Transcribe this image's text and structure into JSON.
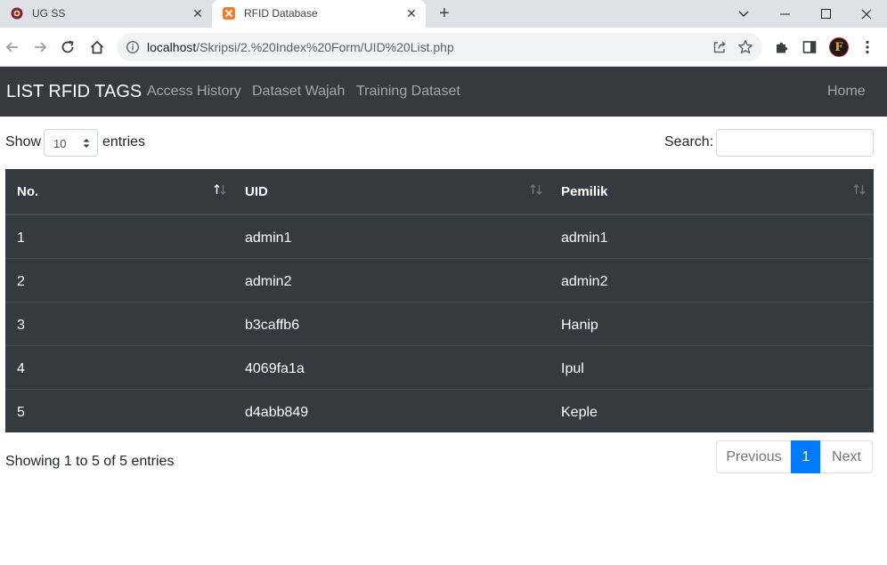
{
  "browser": {
    "tabs": [
      {
        "title": "UG SS",
        "icon": "ug-logo-icon"
      },
      {
        "title": "RFID Database",
        "icon": "xampp-icon",
        "active": true
      }
    ],
    "url_host": "localhost",
    "url_path": "/Skripsi/2.%20Index%20Form/UID%20List.php"
  },
  "navbar": {
    "brand": "LIST RFID TAGS",
    "links": [
      "Access History",
      "Dataset Wajah",
      "Training Dataset"
    ],
    "home": "Home"
  },
  "controls": {
    "show_label": "Show",
    "page_length": "10",
    "entries_label": "entries",
    "search_label": "Search:",
    "search_value": ""
  },
  "table": {
    "headers": [
      "No.",
      "UID",
      "Pemilik"
    ],
    "rows": [
      [
        "1",
        "admin1",
        "admin1"
      ],
      [
        "2",
        "admin2",
        "admin2"
      ],
      [
        "3",
        "b3caffb6",
        "Hanip"
      ],
      [
        "4",
        "4069fa1a",
        "Ipul"
      ],
      [
        "5",
        "d4abb849",
        "Keple"
      ]
    ]
  },
  "footer": {
    "info": "Showing 1 to 5 of 5 entries",
    "previous": "Previous",
    "current_page": "1",
    "next": "Next"
  },
  "colors": {
    "navbar_bg": "#343a40",
    "table_bg": "#343a40",
    "active_page": "#007bff"
  }
}
